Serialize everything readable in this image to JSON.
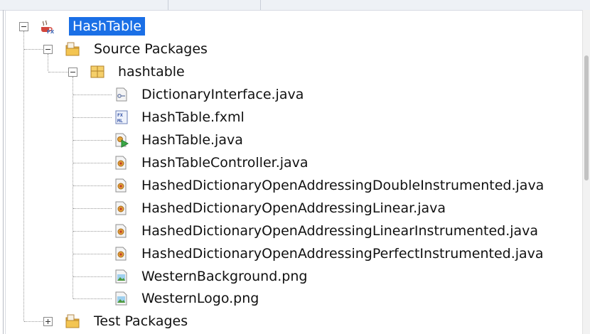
{
  "tree": {
    "project": {
      "label": "HashTable",
      "icon": "javafx-project-icon",
      "selected": true,
      "expanded": true
    },
    "source_packages": {
      "label": "Source Packages",
      "icon": "source-folder-icon",
      "expanded": true
    },
    "package": {
      "label": "hashtable",
      "icon": "package-icon",
      "expanded": true
    },
    "files": [
      {
        "label": "DictionaryInterface.java",
        "icon": "interface-file-icon"
      },
      {
        "label": "HashTable.fxml",
        "icon": "fxml-file-icon"
      },
      {
        "label": "HashTable.java",
        "icon": "main-class-file-icon"
      },
      {
        "label": "HashTableController.java",
        "icon": "java-class-file-icon"
      },
      {
        "label": "HashedDictionaryOpenAddressingDoubleInstrumented.java",
        "icon": "java-class-file-icon"
      },
      {
        "label": "HashedDictionaryOpenAddressingLinear.java",
        "icon": "java-class-file-icon"
      },
      {
        "label": "HashedDictionaryOpenAddressingLinearInstrumented.java",
        "icon": "java-class-file-icon"
      },
      {
        "label": "HashedDictionaryOpenAddressingPerfectInstrumented.java",
        "icon": "java-class-file-icon"
      },
      {
        "label": "WesternBackground.png",
        "icon": "image-file-icon"
      },
      {
        "label": "WesternLogo.png",
        "icon": "image-file-icon"
      }
    ],
    "test_packages": {
      "label": "Test Packages",
      "icon": "test-folder-icon",
      "expanded": false
    }
  },
  "colors": {
    "selection": "#1a6fe6",
    "text": "#111111",
    "tree_lines": "#9a9a9a"
  }
}
